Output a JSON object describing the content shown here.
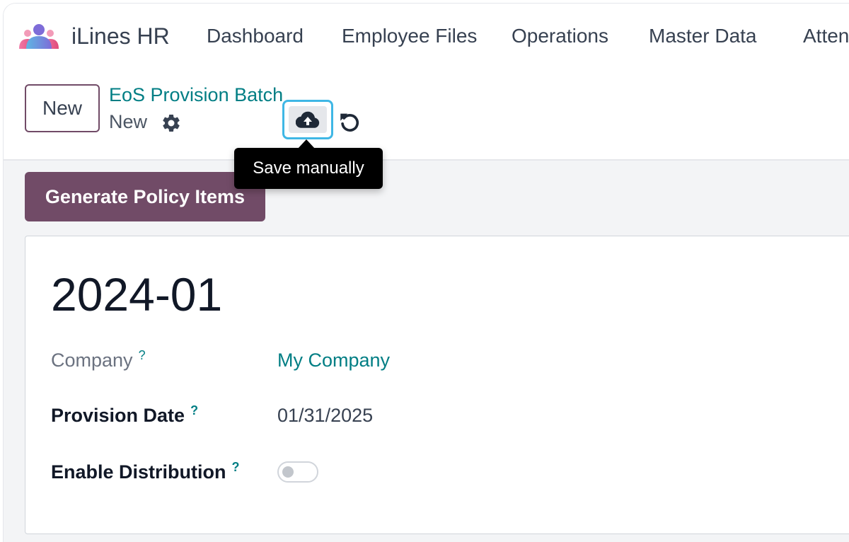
{
  "app": {
    "name": "iLines HR",
    "logo_icon": "users-logo-icon"
  },
  "nav": {
    "items": [
      {
        "label": "Dashboard"
      },
      {
        "label": "Employee Files"
      },
      {
        "label": "Operations"
      },
      {
        "label": "Master Data"
      },
      {
        "label": "Attendance"
      }
    ]
  },
  "control_panel": {
    "new_button": "New",
    "breadcrumb_parent": "EoS Provision Batch",
    "record_status": "New",
    "save_tooltip": "Save manually"
  },
  "actions": {
    "generate_button": "Generate Policy Items"
  },
  "form": {
    "record_name": "2024-01",
    "fields": {
      "company": {
        "label": "Company",
        "value": "My Company"
      },
      "provision_date": {
        "label": "Provision Date",
        "value": "01/31/2025"
      },
      "enable_distribution": {
        "label": "Enable Distribution",
        "enabled": false
      }
    }
  },
  "colors": {
    "brand_primary": "#714b67",
    "link": "#017e84",
    "focus_ring": "#3fb7e5"
  }
}
